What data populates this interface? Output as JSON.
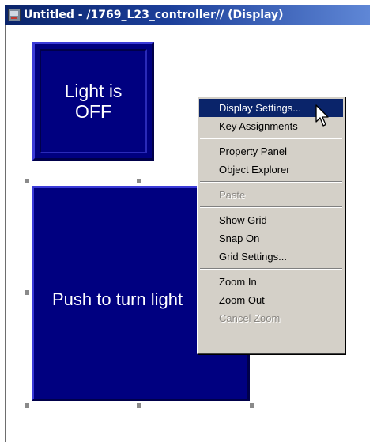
{
  "window": {
    "title": "Untitled - /1769_L23_controller// (Display)",
    "title_bar_color": "#0a246a",
    "app_icon": "display-editor-icon"
  },
  "canvas": {
    "indicator": {
      "label": "Light is\nOFF",
      "background": "#000080",
      "text_color": "#ffffff"
    },
    "pushbutton": {
      "label": "Push to turn light",
      "background": "#000080",
      "text_color": "#ffffff"
    }
  },
  "context_menu": {
    "items": [
      {
        "label": "Display Settings...",
        "state": "selected"
      },
      {
        "label": "Key Assignments",
        "state": "normal"
      },
      {
        "type": "separator"
      },
      {
        "label": "Property Panel",
        "state": "normal"
      },
      {
        "label": "Object Explorer",
        "state": "normal"
      },
      {
        "type": "separator"
      },
      {
        "label": "Paste",
        "state": "disabled"
      },
      {
        "type": "separator"
      },
      {
        "label": "Show Grid",
        "state": "normal"
      },
      {
        "label": "Snap On",
        "state": "normal"
      },
      {
        "label": "Grid Settings...",
        "state": "normal"
      },
      {
        "type": "separator"
      },
      {
        "label": "Zoom In",
        "state": "normal"
      },
      {
        "label": "Zoom Out",
        "state": "normal"
      },
      {
        "label": "Cancel Zoom",
        "state": "disabled"
      }
    ],
    "highlight_color": "#0a246a",
    "cursor_icon": "arrow-pointer-icon"
  }
}
